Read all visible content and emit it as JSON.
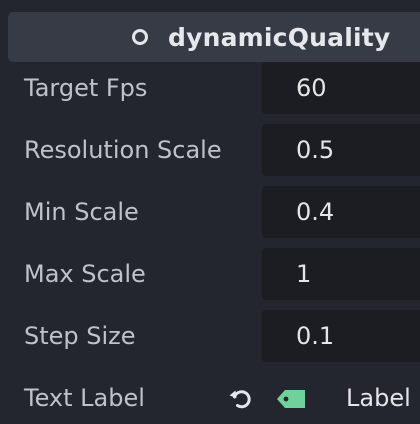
{
  "header": {
    "title": "dynamicQuality",
    "icon": "circle-icon"
  },
  "properties": [
    {
      "label": "Target Fps",
      "value": "60"
    },
    {
      "label": "Resolution Scale",
      "value": "0.5"
    },
    {
      "label": "Min Scale",
      "value": "0.4"
    },
    {
      "label": "Max Scale",
      "value": "1"
    },
    {
      "label": "Step Size",
      "value": "0.1"
    }
  ],
  "text_label_row": {
    "label": "Text Label",
    "value": "Label",
    "revert_icon": "revert-icon",
    "type_icon": "tag-icon"
  },
  "colors": {
    "background": "#23262e",
    "header": "#363b46",
    "field": "#1b1d22",
    "tag_accent": "#6fd29b"
  }
}
